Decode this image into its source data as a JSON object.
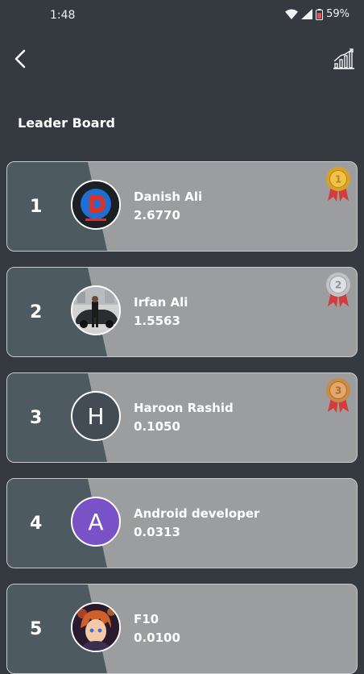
{
  "status_bar": {
    "time": "1:48",
    "battery": "59%"
  },
  "header": {
    "back_icon": "chevron-left-icon",
    "stats_icon": "bar-chart-icon"
  },
  "page": {
    "title": "Leader Board"
  },
  "entries": [
    {
      "rank": "1",
      "name": "Danish Ali",
      "score": "2.6770",
      "avatar_type": "logo",
      "medal": "gold",
      "medal_text": "1"
    },
    {
      "rank": "2",
      "name": "Irfan Ali",
      "score": "1.5563",
      "avatar_type": "photo-car",
      "medal": "silver",
      "medal_text": "2"
    },
    {
      "rank": "3",
      "name": "Haroon Rashid",
      "score": "0.1050",
      "avatar_type": "initial",
      "avatar_letter": "H",
      "avatar_color": "#434b54",
      "medal": "bronze",
      "medal_text": "3"
    },
    {
      "rank": "4",
      "name": "Android developer",
      "score": "0.0313",
      "avatar_type": "initial",
      "avatar_letter": "A",
      "avatar_color": "#7a52c7"
    },
    {
      "rank": "5",
      "name": "F10",
      "score": "0.0100",
      "avatar_type": "photo-anime"
    }
  ],
  "colors": {
    "background": "#353a40",
    "card": "#9c9d9f",
    "card_stripe": "#4e5a61",
    "gold": "#d9a227",
    "silver": "#c9cbce",
    "bronze": "#c98a4a",
    "ribbon": "#d43b3b"
  }
}
